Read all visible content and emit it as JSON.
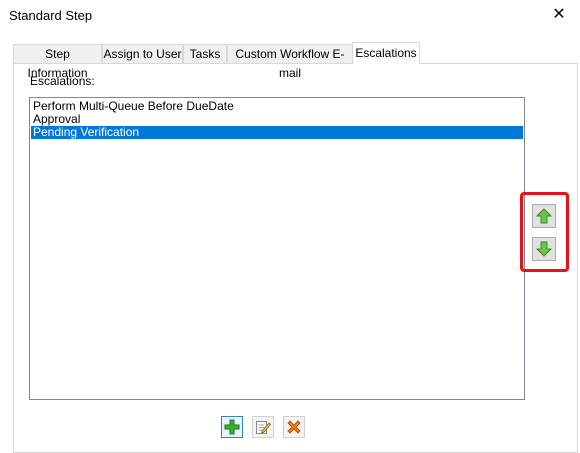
{
  "window": {
    "title": "Standard Step",
    "close_glyph": "✕"
  },
  "tabs": [
    {
      "label": "Step Information"
    },
    {
      "label": "Assign to User"
    },
    {
      "label": "Tasks"
    },
    {
      "label": "Custom Workflow E-mail"
    },
    {
      "label": "Escalations",
      "active": true
    }
  ],
  "escalations": {
    "label": "Escalations:",
    "items": [
      {
        "label": "Perform Multi-Queue Before DueDate",
        "selected": false
      },
      {
        "label": "Approval",
        "selected": false
      },
      {
        "label": "Pending Verification",
        "selected": true
      }
    ]
  },
  "reorder_buttons": [
    {
      "icon": "arrow-up-icon"
    },
    {
      "icon": "arrow-down-icon"
    }
  ],
  "action_buttons": [
    {
      "icon": "add-icon"
    },
    {
      "icon": "edit-icon"
    },
    {
      "icon": "delete-icon"
    }
  ],
  "colors": {
    "selection": "#0078d7",
    "highlight_border": "#e8101a",
    "arrow_green": "#6cc24a",
    "add_green": "#3fae2a",
    "delete_orange": "#f07a1a"
  }
}
